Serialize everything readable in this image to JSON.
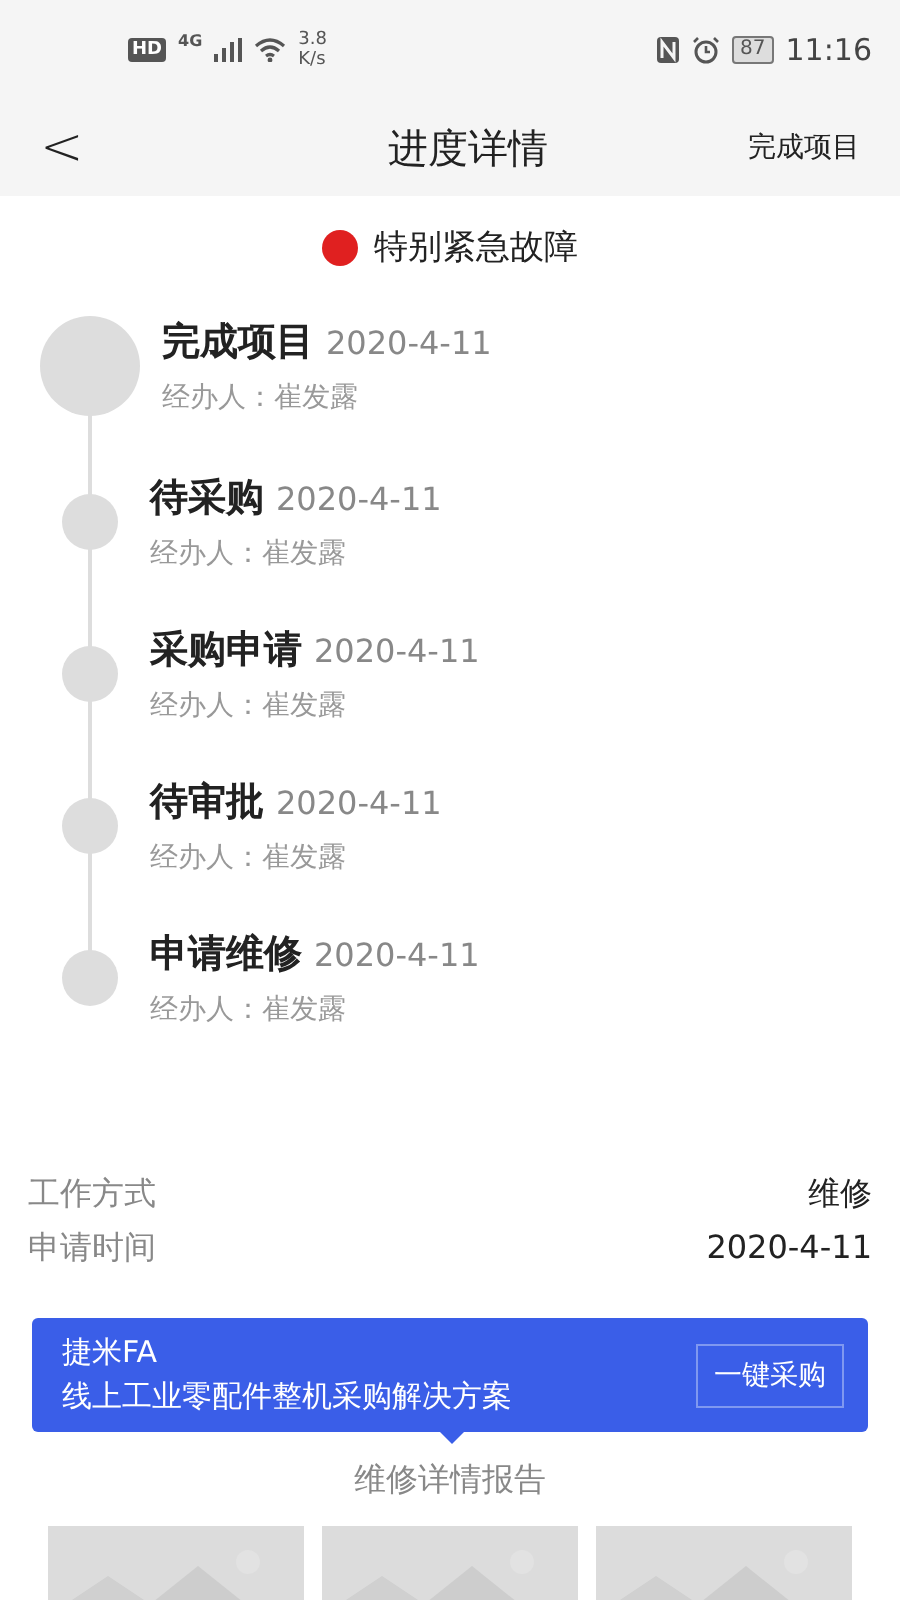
{
  "status_bar": {
    "hd": "HD",
    "network": "4G",
    "speed_value": "3.8",
    "speed_unit": "K/s",
    "battery": "87",
    "time": "11:16"
  },
  "nav": {
    "back": "<",
    "title": "进度详情",
    "action": "完成项目"
  },
  "priority": {
    "label": "特别紧急故障",
    "color": "#e02020"
  },
  "timeline": [
    {
      "title": "完成项目",
      "date": "2020-4-11",
      "handler": "经办人：崔发露",
      "current": true
    },
    {
      "title": "待采购",
      "date": "2020-4-11",
      "handler": "经办人：崔发露",
      "current": false
    },
    {
      "title": "采购申请",
      "date": "2020-4-11",
      "handler": "经办人：崔发露",
      "current": false
    },
    {
      "title": "待审批",
      "date": "2020-4-11",
      "handler": "经办人：崔发露",
      "current": false
    },
    {
      "title": "申请维修",
      "date": "2020-4-11",
      "handler": "经办人：崔发露",
      "current": false
    }
  ],
  "details": [
    {
      "label": "工作方式",
      "value": "维修"
    },
    {
      "label": "申请时间",
      "value": "2020-4-11"
    }
  ],
  "banner": {
    "title": "捷米FA",
    "subtitle": "线上工业零配件整机采购解决方案",
    "button": "一键采购"
  },
  "report": {
    "title": "维修详情报告"
  }
}
